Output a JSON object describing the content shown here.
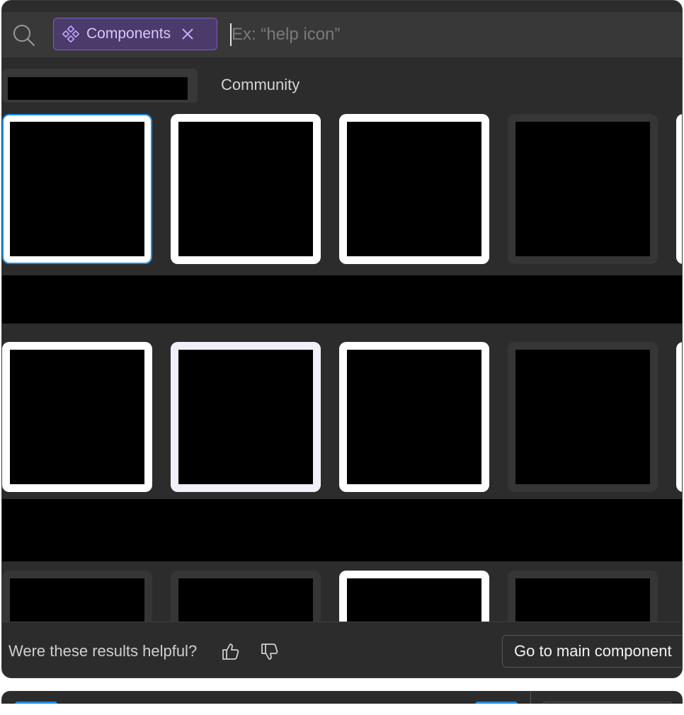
{
  "search": {
    "filter_chip_label": "Components",
    "placeholder": "Ex: “help icon”",
    "value": ""
  },
  "tabs": {
    "community_label": "Community"
  },
  "grid": {
    "rows": [
      [
        {
          "style": "white",
          "selected": true
        },
        {
          "style": "white",
          "selected": false
        },
        {
          "style": "white",
          "selected": false
        },
        {
          "style": "dark",
          "selected": false
        }
      ],
      [
        {
          "style": "white",
          "selected": false
        },
        {
          "style": "lavender",
          "selected": false
        },
        {
          "style": "white",
          "selected": false
        },
        {
          "style": "dark",
          "selected": false
        }
      ],
      [
        {
          "style": "dark",
          "selected": false
        },
        {
          "style": "dark",
          "selected": false
        },
        {
          "style": "white",
          "selected": false
        },
        {
          "style": "dark",
          "selected": false
        }
      ]
    ]
  },
  "footer": {
    "feedback_question": "Were these results helpful?",
    "main_component_button": "Go to main component"
  },
  "colors": {
    "panel_bg": "#2c2c2c",
    "chip_bg": "#4b3b6b",
    "chip_text": "#d9c6ff",
    "selection_blue": "#1e8fe6"
  },
  "icons": {
    "search": "search-icon",
    "component": "component-icon",
    "close": "close-icon",
    "thumbs_up": "thumbs-up-icon",
    "thumbs_down": "thumbs-down-icon"
  }
}
